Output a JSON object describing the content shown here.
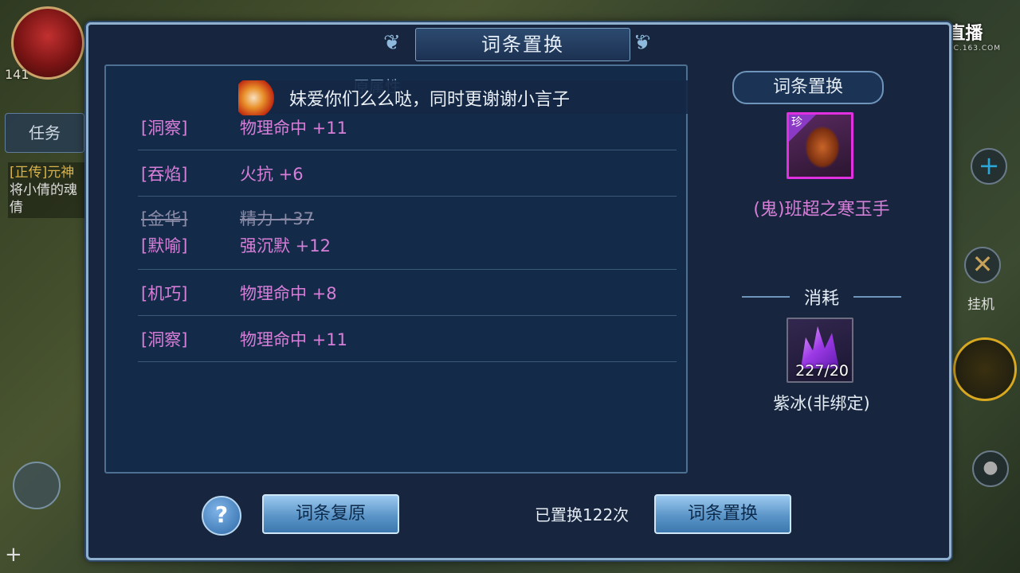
{
  "hud": {
    "level": "141",
    "task_tab": "任务",
    "quest_tag": "[正传]元神",
    "quest_text": "将小倩的魂倩",
    "hangup_label": "挂机",
    "live_logo": "直播",
    "live_domain": "CC.163.COM",
    "plus_icon": "+"
  },
  "dialog": {
    "title": "词条置换",
    "panel_subtitle": "原属性",
    "broadcast": "妹爱你们么么哒，同时更谢谢小言子",
    "attributes": [
      {
        "tag": "[洞察]",
        "value": "物理命中 +11",
        "replaced": false
      },
      {
        "tag": "[吞焰]",
        "value": "火抗 +6",
        "replaced": false
      },
      {
        "tag": "[金华]",
        "value": "精力 +37",
        "replaced": true
      },
      {
        "tag": "[默喻]",
        "value": "强沉默 +12",
        "replaced": false
      },
      {
        "tag": "[机巧]",
        "value": "物理命中 +8",
        "replaced": false
      },
      {
        "tag": "[洞察]",
        "value": "物理命中 +11",
        "replaced": false
      }
    ],
    "right": {
      "title": "词条置换",
      "item_badge": "珍",
      "item_name": "(鬼)班超之寒玉手",
      "consume_title": "消耗",
      "crystal_count": "227/20",
      "crystal_name": "紫冰(非绑定)"
    },
    "bottom": {
      "help_label": "?",
      "restore_button": "词条复原",
      "swap_count": "已置换122次",
      "swap_button": "词条置换"
    }
  },
  "colors": {
    "attribute_purple": "#d77fd8",
    "panel_bg": "#142a49",
    "button_blue": "#5b95c8"
  }
}
